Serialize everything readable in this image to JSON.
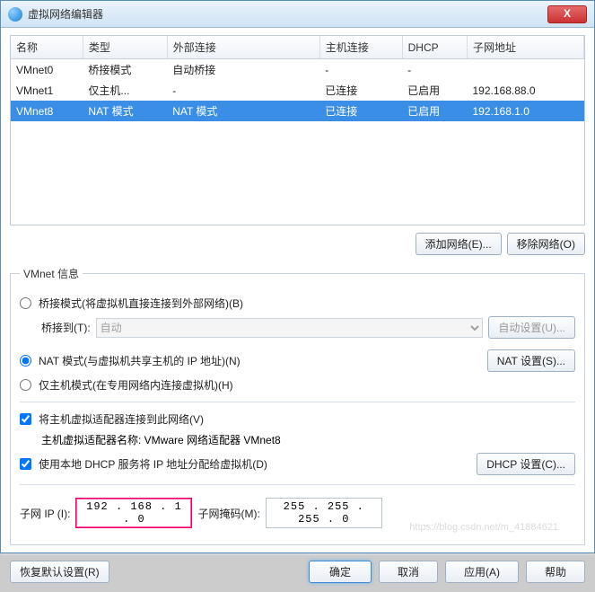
{
  "window": {
    "title": "虚拟网络编辑器",
    "close": "X"
  },
  "table": {
    "headers": {
      "name": "名称",
      "type": "类型",
      "ext": "外部连接",
      "host": "主机连接",
      "dhcp": "DHCP",
      "subnet": "子网地址"
    },
    "rows": [
      {
        "name": "VMnet0",
        "type": "桥接模式",
        "ext": "自动桥接",
        "host": "-",
        "dhcp": "-",
        "subnet": ""
      },
      {
        "name": "VMnet1",
        "type": "仅主机...",
        "ext": "-",
        "host": "已连接",
        "dhcp": "已启用",
        "subnet": "192.168.88.0"
      },
      {
        "name": "VMnet8",
        "type": "NAT 模式",
        "ext": "NAT 模式",
        "host": "已连接",
        "dhcp": "已启用",
        "subnet": "192.168.1.0"
      }
    ]
  },
  "buttons": {
    "addNet": "添加网络(E)...",
    "removeNet": "移除网络(O)",
    "autoSet": "自动设置(U)...",
    "natSet": "NAT 设置(S)...",
    "dhcpSet": "DHCP 设置(C)...",
    "restore": "恢复默认设置(R)",
    "ok": "确定",
    "cancel": "取消",
    "apply": "应用(A)",
    "help": "帮助"
  },
  "group": {
    "legend": "VMnet 信息",
    "bridged": "桥接模式(将虚拟机直接连接到外部网络)(B)",
    "bridgedTo": "桥接到(T):",
    "bridgedToValue": "自动",
    "nat": "NAT 模式(与虚拟机共享主机的 IP 地址)(N)",
    "hostOnly": "仅主机模式(在专用网络内连接虚拟机)(H)",
    "hostAdapter": "将主机虚拟适配器连接到此网络(V)",
    "hostAdapterName": "主机虚拟适配器名称: VMware 网络适配器 VMnet8",
    "useDhcp": "使用本地 DHCP 服务将 IP 地址分配给虚拟机(D)"
  },
  "subnet": {
    "ipLabel": "子网 IP (I):",
    "ipValue": "192 . 168 .  1  .  0",
    "maskLabel": "子网掩码(M):",
    "maskValue": "255 . 255 . 255 .  0"
  },
  "watermark": "https://blog.csdn.net/m_41884621"
}
